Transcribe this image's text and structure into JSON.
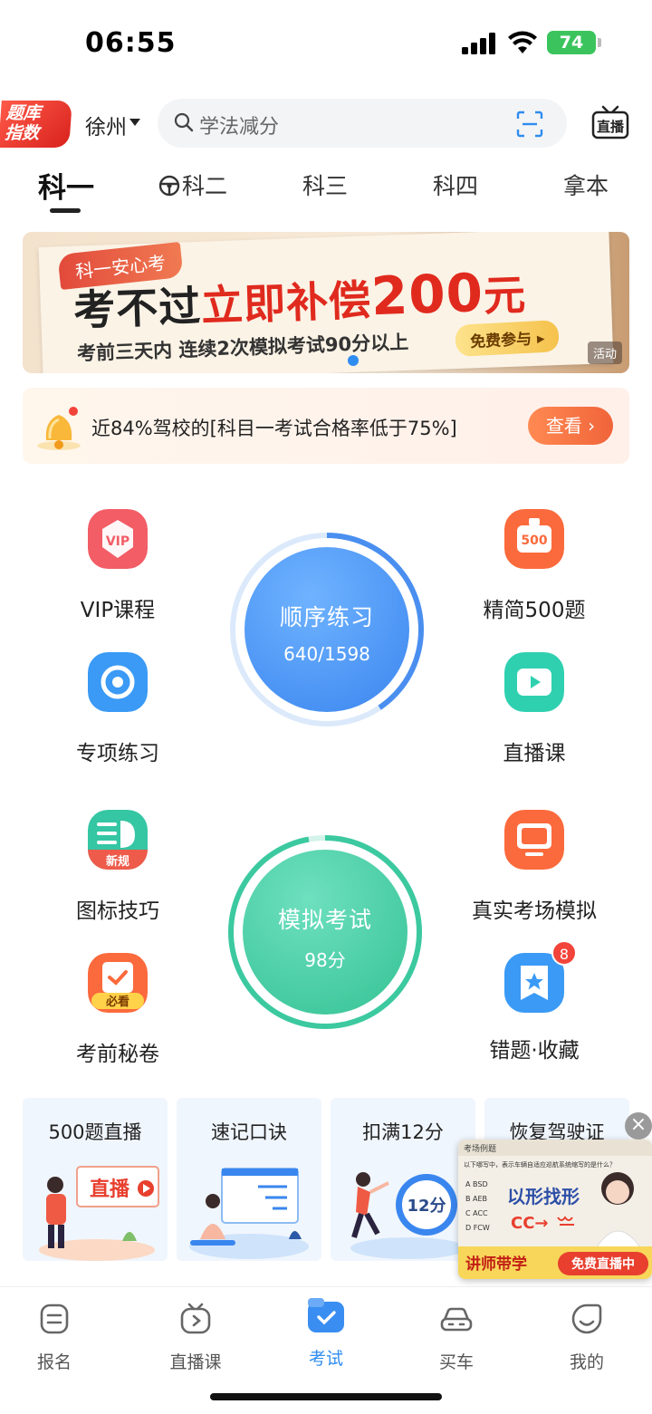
{
  "status_bar": {
    "time": "06:55",
    "battery": "74"
  },
  "header": {
    "badge_line1": "题库",
    "badge_line2": "指数",
    "city": "徐州",
    "search_placeholder": "学法减分",
    "live_icon_text": "直播"
  },
  "tabs": [
    {
      "label": "科一",
      "active": true
    },
    {
      "label": "科二",
      "active": false
    },
    {
      "label": "科三",
      "active": false
    },
    {
      "label": "科四",
      "active": false
    },
    {
      "label": "拿本",
      "active": false
    }
  ],
  "banner": {
    "tag": "科一安心考",
    "title_part1": "考不过",
    "title_part2": "立即补偿",
    "title_amount": "200",
    "title_unit": "元",
    "subtitle": "考前三天内 连续2次模拟考试90分以上",
    "cta": "免费参与 ▸",
    "badge": "活动"
  },
  "notice": {
    "text": "近84%驾校的[科目一考试合格率低于75%]",
    "button": "查看 ›"
  },
  "features": {
    "vip": {
      "label": "VIP课程",
      "icon_text": "VIP"
    },
    "jingjian": {
      "label": "精简500题",
      "icon_text": "500"
    },
    "zhuanxiang": {
      "label": "专项练习"
    },
    "zhibo": {
      "label": "直播课"
    },
    "tubiao": {
      "label": "图标技巧",
      "icon_text": "新规"
    },
    "zhenshi": {
      "label": "真实考场模拟"
    },
    "miquan": {
      "label": "考前秘卷",
      "icon_text": "必看"
    },
    "cuoti": {
      "label": "错题·收藏",
      "badge": "8"
    }
  },
  "practice_ring": {
    "title": "顺序练习",
    "progress_text": "640/1598",
    "progress_value": 640,
    "progress_total": 1598
  },
  "exam_ring": {
    "title": "模拟考试",
    "score_text": "98分"
  },
  "cards": [
    {
      "title": "500题直播",
      "art_text": "直播"
    },
    {
      "title": "速记口诀"
    },
    {
      "title": "扣满12分",
      "art_text": "12分"
    },
    {
      "title": "恢复驾驶证"
    }
  ],
  "float_ad": {
    "header": "考场例题",
    "question": "以下哪写中，表示车辆自适应巡航系统缩写的是什么？",
    "options": [
      "A  BSD",
      "B  AEB",
      "C  ACC",
      "D  FCW"
    ],
    "headline": "以形找形",
    "formula": "CC→",
    "footer_left": "讲师带学",
    "footer_right": "免费直播中"
  },
  "bottom_nav": [
    {
      "label": "报名",
      "active": false
    },
    {
      "label": "直播课",
      "active": false
    },
    {
      "label": "考试",
      "active": true
    },
    {
      "label": "买车",
      "active": false
    },
    {
      "label": "我的",
      "active": false
    }
  ],
  "colors": {
    "accent_blue": "#2f8cf0",
    "accent_green": "#3cc9a0",
    "brand_red": "#e02a1e",
    "cta_orange": "#f0643a"
  }
}
